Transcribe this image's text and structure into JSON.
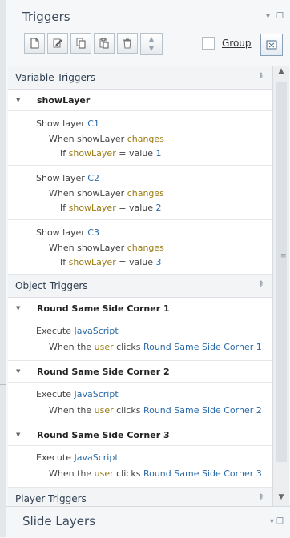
{
  "panel": {
    "title": "Triggers",
    "group_label": "Group"
  },
  "sections": {
    "variable": {
      "label": "Variable Triggers",
      "item": "showLayer",
      "triggers": [
        {
          "a": "Show layer ",
          "layer": "C1",
          "b": "When showLayer ",
          "changes": "changes",
          "c": "If ",
          "var": "showLayer",
          "d": " = value ",
          "val": "1"
        },
        {
          "a": "Show layer ",
          "layer": "C2",
          "b": "When showLayer ",
          "changes": "changes",
          "c": "If ",
          "var": "showLayer",
          "d": " = value ",
          "val": "2"
        },
        {
          "a": "Show layer ",
          "layer": "C3",
          "b": "When showLayer ",
          "changes": "changes",
          "c": "If ",
          "var": "showLayer",
          "d": " = value ",
          "val": "3"
        }
      ]
    },
    "object": {
      "label": "Object Triggers",
      "items": [
        {
          "name": "Round Same Side Corner 1",
          "exec": "Execute ",
          "js": "JavaScript",
          "when": "When the ",
          "user": "user",
          "clicks": " clicks ",
          "target": "Round Same Side Corner 1"
        },
        {
          "name": "Round Same Side Corner 2",
          "exec": "Execute ",
          "js": "JavaScript",
          "when": "When the ",
          "user": "user",
          "clicks": " clicks ",
          "target": "Round Same Side Corner 2"
        },
        {
          "name": "Round Same Side Corner 3",
          "exec": "Execute ",
          "js": "JavaScript",
          "when": "When the ",
          "user": "user",
          "clicks": " clicks ",
          "target": "Round Same Side Corner 3"
        }
      ]
    },
    "player": {
      "label": "Player Triggers"
    }
  },
  "bottom": {
    "label": "Slide Layers"
  }
}
